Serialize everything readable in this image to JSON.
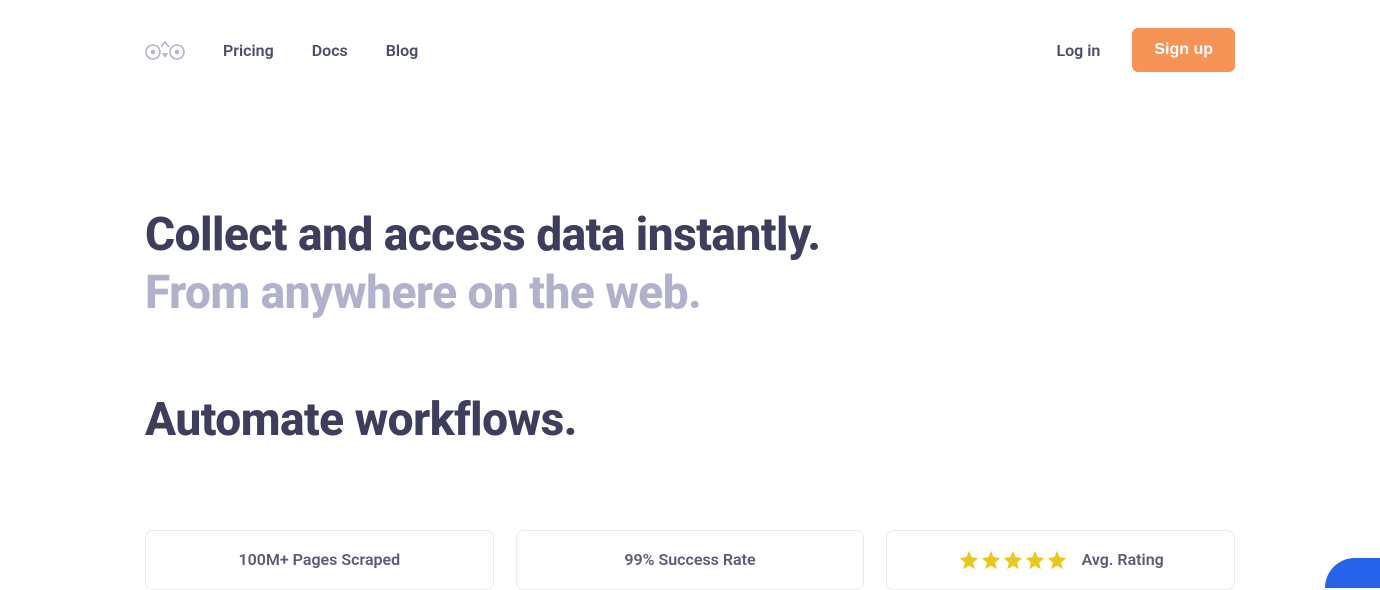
{
  "nav": {
    "pricing": "Pricing",
    "docs": "Docs",
    "blog": "Blog"
  },
  "auth": {
    "login": "Log in",
    "signup": "Sign up"
  },
  "hero": {
    "line1": "Collect and access data instantly.",
    "line2": "From anywhere on the web.",
    "line3": "Automate workflows."
  },
  "stats": {
    "pages_scraped": "100M+ Pages Scraped",
    "success_rate": "99% Success Rate",
    "avg_rating_label": "Avg. Rating",
    "star_count": 5
  }
}
